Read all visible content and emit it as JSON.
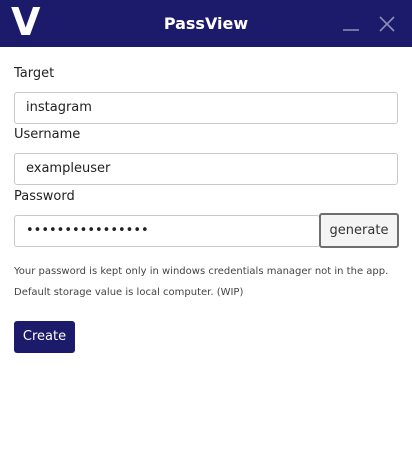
{
  "window": {
    "logo_letter": "V",
    "title": "PassView",
    "accent": "#1c1a6b"
  },
  "form": {
    "target_label": "Target",
    "target_value": "instagram",
    "username_label": "Username",
    "username_value": "exampleuser",
    "password_label": "Password",
    "password_value": "••••••••••••••••",
    "generate_label": "generate",
    "hint_line1": "Your password is kept only in windows credentials manager not in the app.",
    "hint_line2": "Default storage value is local computer. (WIP)",
    "create_label": "Create"
  },
  "icons": {
    "minimize": "minimize-icon",
    "close": "close-icon"
  }
}
